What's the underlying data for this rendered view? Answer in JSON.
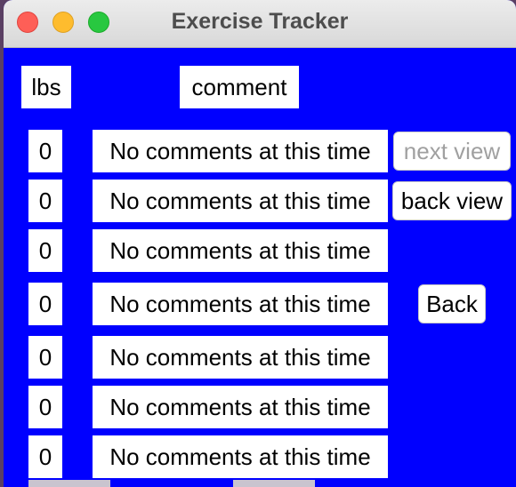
{
  "window": {
    "title": "Exercise Tracker"
  },
  "headers": {
    "lbs": "lbs",
    "comment": "comment"
  },
  "rows": [
    {
      "lbs": "0",
      "comment": "No comments at this time"
    },
    {
      "lbs": "0",
      "comment": "No comments at this time"
    },
    {
      "lbs": "0",
      "comment": "No comments at this time"
    },
    {
      "lbs": "0",
      "comment": "No comments at this time"
    },
    {
      "lbs": "0",
      "comment": "No comments at this time"
    },
    {
      "lbs": "0",
      "comment": "No comments at this time"
    },
    {
      "lbs": "0",
      "comment": "No comments at this time"
    }
  ],
  "buttons": {
    "next_view": "next view",
    "back_view": "back view",
    "back": "Back"
  },
  "colors": {
    "background": "#0000ff"
  }
}
